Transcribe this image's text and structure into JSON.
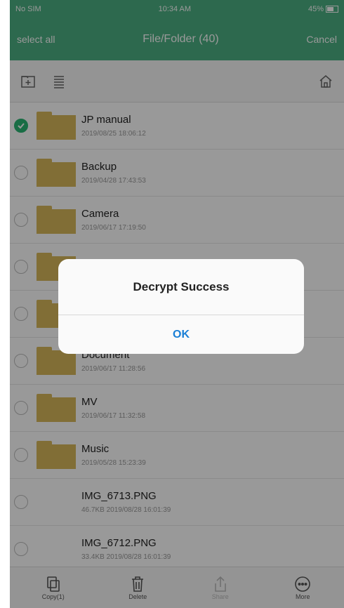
{
  "status_bar": {
    "carrier": "No SIM",
    "time": "10:34 AM",
    "battery": "45%"
  },
  "nav": {
    "left": "select all",
    "title": "File/Folder (40)",
    "right": "Cancel"
  },
  "items": [
    {
      "name": "JP manual",
      "date": "2019/08/25 18:06:12",
      "type": "folder",
      "checked": true
    },
    {
      "name": "Backup",
      "date": "2019/04/28 17:43:53",
      "type": "folder",
      "checked": false
    },
    {
      "name": "Camera",
      "date": "2019/06/17 17:19:50",
      "type": "folder",
      "checked": false
    },
    {
      "name": "",
      "date": "",
      "type": "folder",
      "checked": false
    },
    {
      "name": "",
      "date": "",
      "type": "folder",
      "checked": false
    },
    {
      "name": "Document",
      "date": "2019/06/17 11:28:56",
      "type": "folder",
      "checked": false
    },
    {
      "name": "MV",
      "date": "2019/06/17 11:32:58",
      "type": "folder",
      "checked": false
    },
    {
      "name": "Music",
      "date": "2019/05/28 15:23:39",
      "type": "folder",
      "checked": false
    },
    {
      "name": "IMG_6713.PNG",
      "date": "46.7KB 2019/08/28 16:01:39",
      "type": "file",
      "checked": false
    },
    {
      "name": "IMG_6712.PNG",
      "date": "33.4KB 2019/08/28 16:01:39",
      "type": "file",
      "checked": false
    }
  ],
  "tabbar": {
    "copy": "Copy(1)",
    "delete": "Delete",
    "share": "Share",
    "more": "More"
  },
  "alert": {
    "title": "Decrypt Success",
    "ok": "OK"
  },
  "colors": {
    "brand": "#4caf82",
    "check": "#2bb673",
    "folder": "#d8b75a",
    "link": "#1a7fd6"
  }
}
